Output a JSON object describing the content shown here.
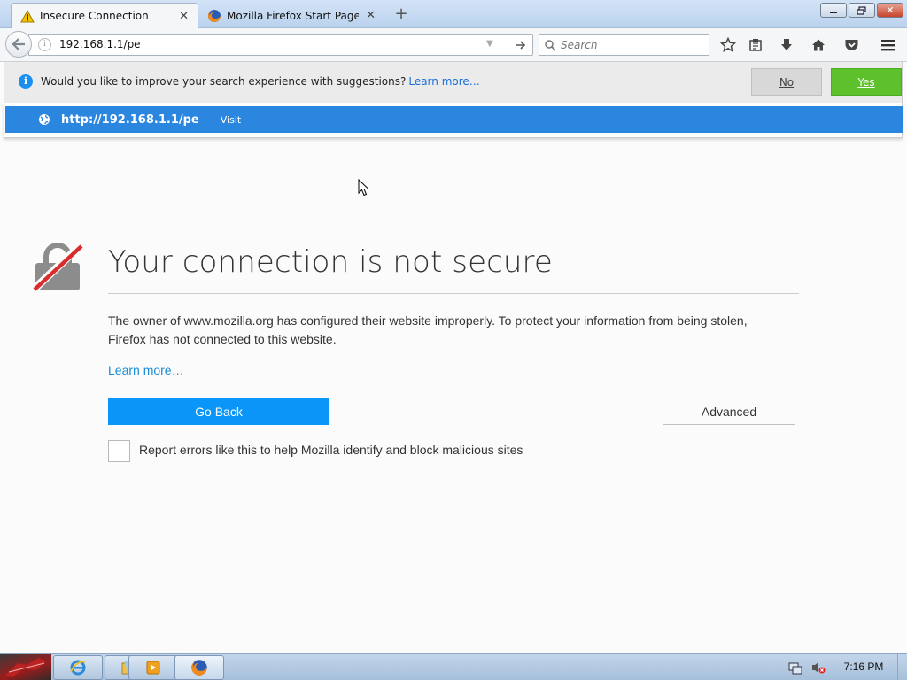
{
  "tabs": [
    {
      "title": "Insecure Connection",
      "icon": "warning-icon",
      "active": true
    },
    {
      "title": "Mozilla Firefox Start Page",
      "icon": "firefox-icon",
      "active": false
    }
  ],
  "navbar": {
    "url": "192.168.1.1/pe",
    "search_placeholder": "Search"
  },
  "suggestions_bar": {
    "message": "Would you like to improve your search experience with suggestions?",
    "learn_more": "Learn more…",
    "no_label": "No",
    "yes_label": "Yes"
  },
  "url_suggestion": {
    "url": "http://192.168.1.1/pe",
    "separator": "—",
    "action": "Visit"
  },
  "error_page": {
    "title": "Your connection is not secure",
    "description": "The owner of www.mozilla.org has configured their website improperly. To protect your information from being stolen, Firefox has not connected to this website.",
    "learn_more": "Learn more…",
    "go_back": "Go Back",
    "advanced": "Advanced",
    "report_label": "Report errors like this to help Mozilla identify and block malicious sites",
    "report_checked": false
  },
  "taskbar": {
    "clock": "7:16 PM",
    "items": [
      "internet-explorer-icon",
      "file-explorer-icon",
      "media-player-icon",
      "firefox-icon"
    ]
  },
  "colors": {
    "primary_button": "#0996f8",
    "yes_button": "#5cc12a",
    "highlight_row": "#2b86e0",
    "link": "#1a8dd6",
    "lock_strike": "#d92d2d"
  }
}
